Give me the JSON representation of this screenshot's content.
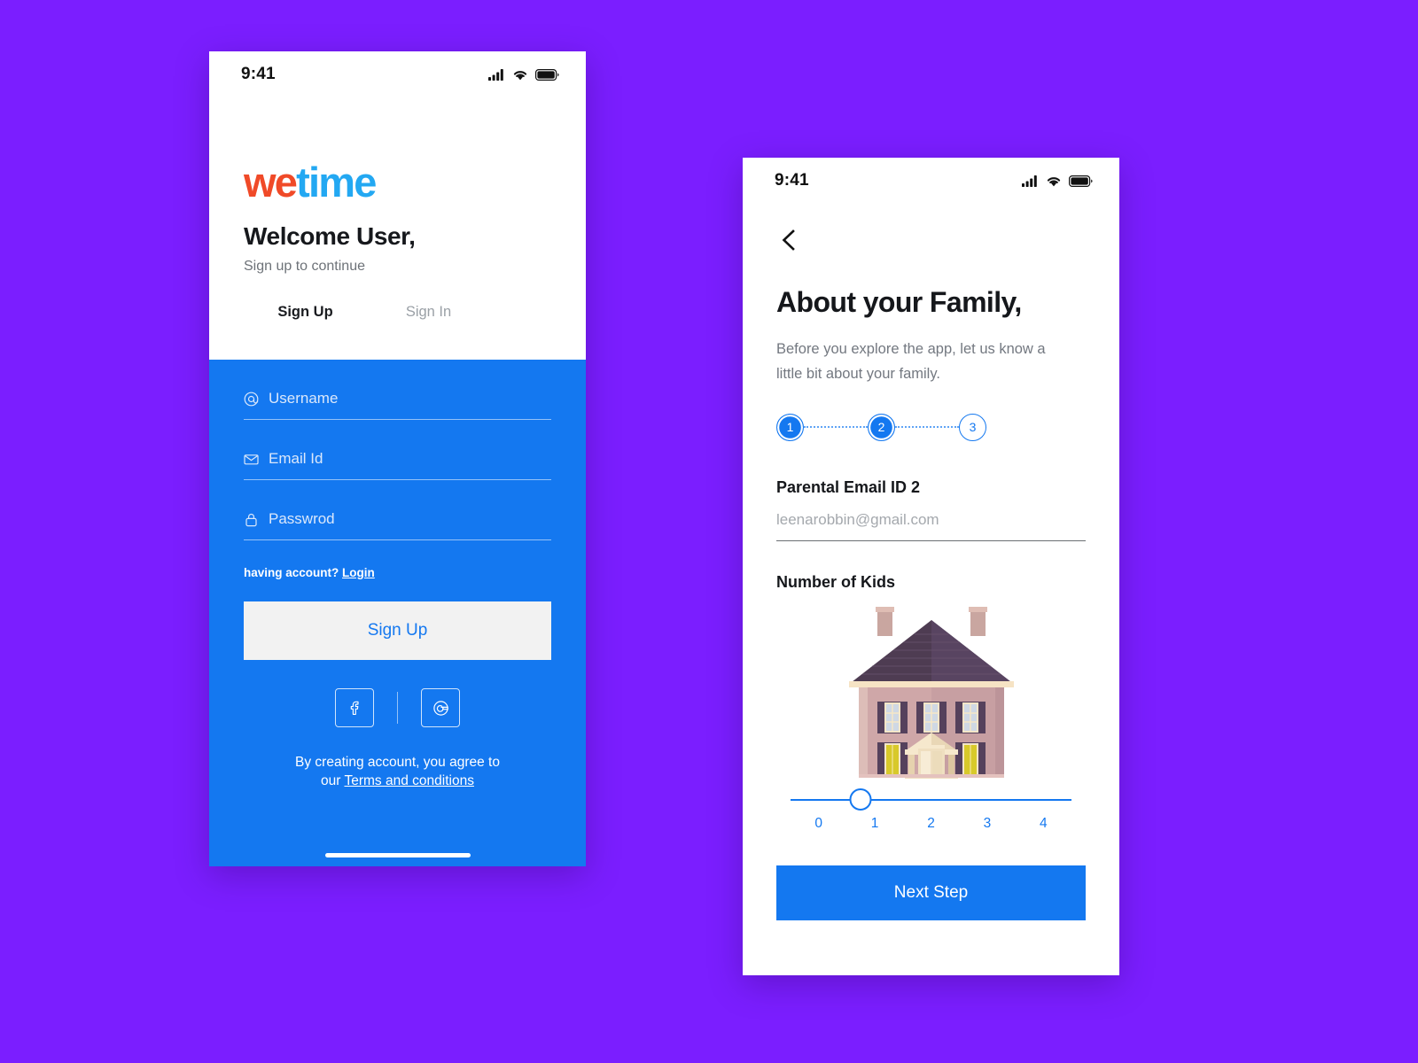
{
  "canvas": {
    "background_color": "#7B1EFF"
  },
  "theme": {
    "blue": "#1478F0",
    "logo_red": "#F04A28",
    "logo_blue": "#23A8F2",
    "purple_bg": "#7B1EFF"
  },
  "signup_screen": {
    "status_bar": {
      "time": "9:41",
      "signal_icon": "cellular-signal-icon",
      "wifi_icon": "wifi-icon",
      "battery_icon": "battery-icon"
    },
    "logo": {
      "part_one": "we",
      "part_two": "time"
    },
    "title": "Welcome User,",
    "subtitle": "Sign up to continue",
    "tabs": [
      {
        "label": "Sign Up",
        "active": true
      },
      {
        "label": "Sign In",
        "active": false
      }
    ],
    "fields": [
      {
        "label": "Username",
        "icon": "at-sign-icon"
      },
      {
        "label": "Email Id",
        "icon": "envelope-icon"
      },
      {
        "label": "Passwrod",
        "icon": "lock-icon"
      }
    ],
    "have_account": {
      "text": "having account?",
      "link": "Login"
    },
    "primary_button": "Sign Up",
    "social_buttons": [
      {
        "name": "facebook",
        "glyph": "f"
      },
      {
        "name": "google",
        "glyph": "G"
      }
    ],
    "terms": {
      "line_one": "By creating account, you agree to",
      "line_two_prefix": "our ",
      "link": "Terms and conditions"
    }
  },
  "family_screen": {
    "status_bar": {
      "time": "9:41",
      "signal_icon": "cellular-signal-icon",
      "wifi_icon": "wifi-icon",
      "battery_icon": "battery-icon"
    },
    "back_icon": "chevron-left-icon",
    "title": "About your Family,",
    "subtitle": "Before you explore the app, let us know a little bit about your family.",
    "steps": [
      {
        "number": "1",
        "state": "done"
      },
      {
        "number": "2",
        "state": "done"
      },
      {
        "number": "3",
        "state": "pending"
      }
    ],
    "email_section": {
      "label": "Parental Email ID 2",
      "placeholder": "leenarobbin@gmail.com",
      "value": ""
    },
    "kids_section": {
      "label": "Number of Kids",
      "illustration": "house-illustration",
      "slider": {
        "min": 0,
        "max": 4,
        "value": 1,
        "ticks": [
          "0",
          "1",
          "2",
          "3",
          "4"
        ]
      }
    },
    "primary_button": "Next Step"
  }
}
